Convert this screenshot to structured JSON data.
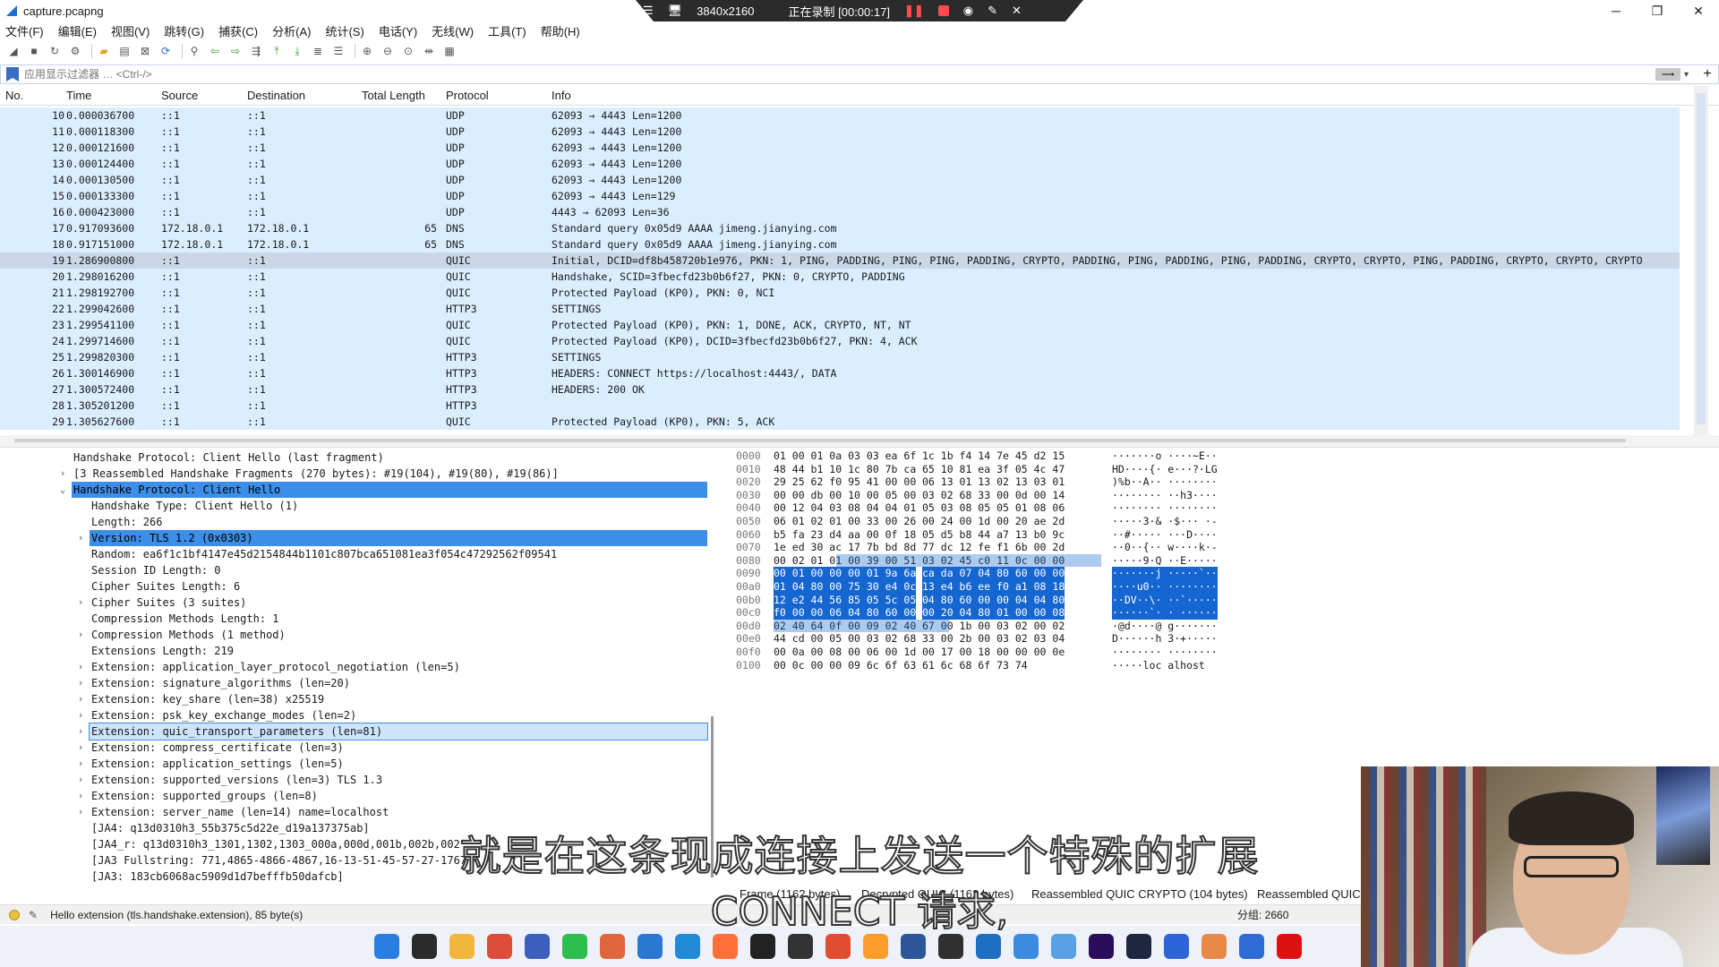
{
  "window": {
    "title": "capture.pcapng"
  },
  "recording": {
    "resolution": "3840x2160",
    "status": "正在录制 [00:00:17]"
  },
  "menu": [
    "文件(F)",
    "编辑(E)",
    "视图(V)",
    "跳转(G)",
    "捕获(C)",
    "分析(A)",
    "统计(S)",
    "电话(Y)",
    "无线(W)",
    "工具(T)",
    "帮助(H)"
  ],
  "filter": {
    "placeholder": "应用显示过滤器 … <Ctrl-/>"
  },
  "packet_list": {
    "columns": [
      "No.",
      "Time",
      "Source",
      "Destination",
      "Total Length",
      "Protocol",
      "Info"
    ],
    "rows": [
      {
        "no": "10",
        "time": "0.000036700",
        "src": "::1",
        "dst": "::1",
        "len": "",
        "proto": "UDP",
        "info": "62093 → 4443 Len=1200"
      },
      {
        "no": "11",
        "time": "0.000118300",
        "src": "::1",
        "dst": "::1",
        "len": "",
        "proto": "UDP",
        "info": "62093 → 4443 Len=1200"
      },
      {
        "no": "12",
        "time": "0.000121600",
        "src": "::1",
        "dst": "::1",
        "len": "",
        "proto": "UDP",
        "info": "62093 → 4443 Len=1200"
      },
      {
        "no": "13",
        "time": "0.000124400",
        "src": "::1",
        "dst": "::1",
        "len": "",
        "proto": "UDP",
        "info": "62093 → 4443 Len=1200"
      },
      {
        "no": "14",
        "time": "0.000130500",
        "src": "::1",
        "dst": "::1",
        "len": "",
        "proto": "UDP",
        "info": "62093 → 4443 Len=1200"
      },
      {
        "no": "15",
        "time": "0.000133300",
        "src": "::1",
        "dst": "::1",
        "len": "",
        "proto": "UDP",
        "info": "62093 → 4443 Len=129"
      },
      {
        "no": "16",
        "time": "0.000423000",
        "src": "::1",
        "dst": "::1",
        "len": "",
        "proto": "UDP",
        "info": "4443 → 62093 Len=36"
      },
      {
        "no": "17",
        "time": "0.917093600",
        "src": "172.18.0.1",
        "dst": "172.18.0.1",
        "len": "65",
        "proto": "DNS",
        "info": "Standard query 0x05d9 AAAA jimeng.jianying.com"
      },
      {
        "no": "18",
        "time": "0.917151000",
        "src": "172.18.0.1",
        "dst": "172.18.0.1",
        "len": "65",
        "proto": "DNS",
        "info": "Standard query 0x05d9 AAAA jimeng.jianying.com"
      },
      {
        "no": "19",
        "time": "1.286900800",
        "src": "::1",
        "dst": "::1",
        "len": "",
        "proto": "QUIC",
        "info": "Initial, DCID=df8b458720b1e976, PKN: 1, PING, PADDING, PING, PING, PADDING, CRYPTO, PADDING, PING, PADDING, PING, PADDING, CRYPTO, CRYPTO, PING, PADDING, CRYPTO, CRYPTO, CRYPTO"
      },
      {
        "no": "20",
        "time": "1.298016200",
        "src": "::1",
        "dst": "::1",
        "len": "",
        "proto": "QUIC",
        "info": "Handshake, SCID=3fbecfd23b0b6f27, PKN: 0, CRYPTO, PADDING"
      },
      {
        "no": "21",
        "time": "1.298192700",
        "src": "::1",
        "dst": "::1",
        "len": "",
        "proto": "QUIC",
        "info": "Protected Payload (KP0), PKN: 0, NCI"
      },
      {
        "no": "22",
        "time": "1.299042600",
        "src": "::1",
        "dst": "::1",
        "len": "",
        "proto": "HTTP3",
        "info": "SETTINGS"
      },
      {
        "no": "23",
        "time": "1.299541100",
        "src": "::1",
        "dst": "::1",
        "len": "",
        "proto": "QUIC",
        "info": "Protected Payload (KP0), PKN: 1, DONE, ACK, CRYPTO, NT, NT"
      },
      {
        "no": "24",
        "time": "1.299714600",
        "src": "::1",
        "dst": "::1",
        "len": "",
        "proto": "QUIC",
        "info": "Protected Payload (KP0), DCID=3fbecfd23b0b6f27, PKN: 4, ACK"
      },
      {
        "no": "25",
        "time": "1.299820300",
        "src": "::1",
        "dst": "::1",
        "len": "",
        "proto": "HTTP3",
        "info": "SETTINGS"
      },
      {
        "no": "26",
        "time": "1.300146900",
        "src": "::1",
        "dst": "::1",
        "len": "",
        "proto": "HTTP3",
        "info": "HEADERS: CONNECT https://localhost:4443/, DATA"
      },
      {
        "no": "27",
        "time": "1.300572400",
        "src": "::1",
        "dst": "::1",
        "len": "",
        "proto": "HTTP3",
        "info": "HEADERS: 200 OK"
      },
      {
        "no": "28",
        "time": "1.305201200",
        "src": "::1",
        "dst": "::1",
        "len": "",
        "proto": "HTTP3",
        "info": ""
      },
      {
        "no": "29",
        "time": "1.305627600",
        "src": "::1",
        "dst": "::1",
        "len": "",
        "proto": "QUIC",
        "info": "Protected Payload (KP0), PKN: 5, ACK"
      }
    ]
  },
  "details": [
    {
      "indent": 0,
      "arrow": "",
      "text": "Handshake Protocol: Client Hello (last fragment)"
    },
    {
      "indent": 0,
      "arrow": ">",
      "text": "[3 Reassembled Handshake Fragments (270 bytes): #19(104), #19(80), #19(86)]"
    },
    {
      "indent": 0,
      "arrow": "v",
      "text": "Handshake Protocol: Client Hello",
      "hl": true
    },
    {
      "indent": 1,
      "arrow": "",
      "text": "Handshake Type: Client Hello (1)"
    },
    {
      "indent": 1,
      "arrow": "",
      "text": "Length: 266"
    },
    {
      "indent": 1,
      "arrow": ">",
      "text": "Version: TLS 1.2 (0x0303)",
      "hl": true
    },
    {
      "indent": 1,
      "arrow": "",
      "text": "Random: ea6f1c1bf4147e45d2154844b1101c807bca651081ea3f054c47292562f09541"
    },
    {
      "indent": 1,
      "arrow": "",
      "text": "Session ID Length: 0"
    },
    {
      "indent": 1,
      "arrow": "",
      "text": "Cipher Suites Length: 6"
    },
    {
      "indent": 1,
      "arrow": ">",
      "text": "Cipher Suites (3 suites)"
    },
    {
      "indent": 1,
      "arrow": "",
      "text": "Compression Methods Length: 1"
    },
    {
      "indent": 1,
      "arrow": ">",
      "text": "Compression Methods (1 method)"
    },
    {
      "indent": 1,
      "arrow": "",
      "text": "Extensions Length: 219"
    },
    {
      "indent": 1,
      "arrow": ">",
      "text": "Extension: application_layer_protocol_negotiation (len=5)"
    },
    {
      "indent": 1,
      "arrow": ">",
      "text": "Extension: signature_algorithms (len=20)"
    },
    {
      "indent": 1,
      "arrow": ">",
      "text": "Extension: key_share (len=38) x25519"
    },
    {
      "indent": 1,
      "arrow": ">",
      "text": "Extension: psk_key_exchange_modes (len=2)"
    },
    {
      "indent": 1,
      "arrow": ">",
      "text": "Extension: quic_transport_parameters (len=81)",
      "hlb": true
    },
    {
      "indent": 1,
      "arrow": ">",
      "text": "Extension: compress_certificate (len=3)"
    },
    {
      "indent": 1,
      "arrow": ">",
      "text": "Extension: application_settings (len=5)"
    },
    {
      "indent": 1,
      "arrow": ">",
      "text": "Extension: supported_versions (len=3) TLS 1.3"
    },
    {
      "indent": 1,
      "arrow": ">",
      "text": "Extension: supported_groups (len=8)"
    },
    {
      "indent": 1,
      "arrow": ">",
      "text": "Extension: server_name (len=14) name=localhost"
    },
    {
      "indent": 1,
      "arrow": "",
      "text": "[JA4: q13d0310h3_55b375c5d22e_d19a137375ab]"
    },
    {
      "indent": 1,
      "arrow": "",
      "text": "[JA4_r: q13d0310h3_1301,1302,1303_000a,000d,001b,002b,002"
    },
    {
      "indent": 1,
      "arrow": "",
      "text": "[JA3 Fullstring: 771,4865-4866-4867,16-13-51-45-57-27-1767"
    },
    {
      "indent": 1,
      "arrow": "",
      "text": "[JA3: 183cb6068ac5909d1d7befffb50dafcb]"
    }
  ],
  "bytes": [
    {
      "off": "0000",
      "h1": "01 00 01 0a 03 03 ea 6f",
      "h2": "1c 1b f4 14 7e 45 d2 15",
      "asc": "·······o ····~E··"
    },
    {
      "off": "0010",
      "h1": "48 44 b1 10 1c 80 7b ca",
      "h2": "65 10 81 ea 3f 05 4c 47",
      "asc": "HD····{· e···?·LG"
    },
    {
      "off": "0020",
      "h1": "29 25 62 f0 95 41 00 00",
      "h2": "06 13 01 13 02 13 03 01",
      "asc": ")%b··A·· ········"
    },
    {
      "off": "0030",
      "h1": "00 00 db 00 10 00 05 00",
      "h2": "03 02 68 33 00 0d 00 14",
      "asc": "········ ··h3····"
    },
    {
      "off": "0040",
      "h1": "00 12 04 03 08 04 04 01",
      "h2": "05 03 08 05 05 01 08 06",
      "asc": "········ ········"
    },
    {
      "off": "0050",
      "h1": "06 01 02 01 00 33 00 26",
      "h2": "00 24 00 1d 00 20 ae 2d",
      "asc": "·····3·& ·$··· ·-"
    },
    {
      "off": "0060",
      "h1": "b5 fa 23 d4 aa 00 0f 18",
      "h2": "05 d5 b8 44 a7 13 b0 9c",
      "asc": "··#····· ···D····"
    },
    {
      "off": "0070",
      "h1": "1e ed 30 ac 17 7b bd 8d",
      "h2": "77 dc 12 fe f1 6b 00 2d",
      "asc": "··0··{·· w····k·-"
    },
    {
      "off": "0080",
      "h1": "00 02 01 01 00 39 00 51",
      "h2": "03 02 45 c0 11 0c 00 00",
      "asc": "·····9·Q ··E·····",
      "sel": "partial"
    },
    {
      "off": "0090",
      "h1": "00 01 00 00 00 01 9a 6a",
      "h2": "ca da 07 04 80 60 00 00",
      "asc": "·······j ·····`··",
      "sel": "full"
    },
    {
      "off": "00a0",
      "h1": "01 04 80 00 75 30 e4 0c",
      "h2": "13 e4 b6 ee f0 a1 08 18",
      "asc": "····u0·· ········",
      "sel": "full"
    },
    {
      "off": "00b0",
      "h1": "12 e2 44 56 85 05 5c 05",
      "h2": "04 80 60 00 00 04 04 80",
      "asc": "··DV··\\· ··`·····",
      "sel": "full"
    },
    {
      "off": "00c0",
      "h1": "f0 00 00 06 04 80 60 00",
      "h2": "00 20 04 80 01 00 00 08",
      "asc": "······`· · ······",
      "sel": "full"
    },
    {
      "off": "00d0",
      "h1": "02 40 64 0f 00 09 02 40",
      "h2": "67 00 1b 00 03 02 00 02",
      "asc": "·@d····@ g·······",
      "sel": "end"
    },
    {
      "off": "00e0",
      "h1": "44 cd 00 05 00 03 02 68",
      "h2": "33 00 2b 00 03 02 03 04",
      "asc": "D······h 3·+·····"
    },
    {
      "off": "00f0",
      "h1": "00 0a 00 08 00 06 00 1d",
      "h2": "00 17 00 18 00 00 00 0e",
      "asc": "········ ········"
    },
    {
      "off": "0100",
      "h1": "00 0c 00 00 09 6c 6f 63",
      "h2": "61 6c 68 6f 73 74",
      "asc": "·····loc alhost"
    }
  ],
  "bottom_tabs": [
    "Frame (1162 bytes)",
    "Decrypted QUIC (1162 bytes)",
    "Reassembled QUIC CRYPTO (104 bytes)",
    "Reassembled QUIC CRYPTO"
  ],
  "status": {
    "field": "Hello extension (tls.handshake.extension), 85 byte(s)",
    "packets": "分组: 2660"
  },
  "subtitles": {
    "line1": "就是在这条现成连接上发送一个特殊的扩展",
    "line2": "CONNECT 请求,"
  },
  "taskbar_apps": [
    "start",
    "explorer",
    "folder",
    "chrome",
    "save",
    "wechat",
    "app",
    "vscode",
    "edge",
    "firefox",
    "chatgpt",
    "terminal",
    "git",
    "search",
    "word",
    "obs",
    "app",
    "chat",
    "app",
    "premiere",
    "app",
    "notes",
    "app",
    "wireshark",
    "record"
  ],
  "colors": {
    "row_bg": "#daeeff",
    "row_selected": "#c9d7e6",
    "tree_highlight": "#3c8ee8",
    "hex_highlight": "#1566d1"
  }
}
